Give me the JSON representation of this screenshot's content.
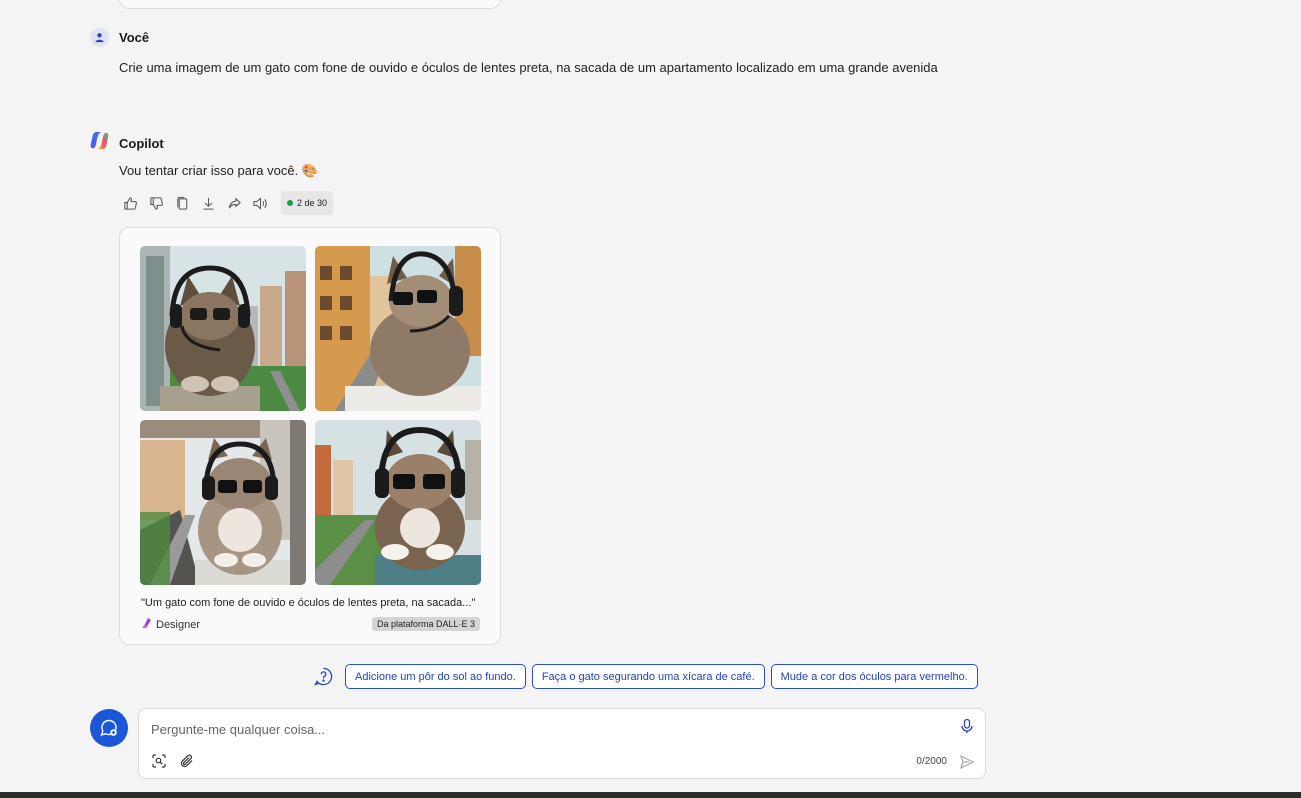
{
  "user_message": {
    "sender": "Você",
    "text": "Crie uma imagem de um gato com fone de ouvido e óculos de lentes preta, na sacada de um apartamento localizado em uma grande avenida"
  },
  "copilot_message": {
    "sender": "Copilot",
    "text": "Vou tentar criar isso para você. 🎨",
    "counter": "2 de 30",
    "counter_color": "#1a9c4b"
  },
  "image_card": {
    "caption": "\"Um gato com fone de ouvido e óculos de lentes preta, na sacada...\"",
    "designer_label": "Designer",
    "platform_label": "Da plataforma DALL·E 3"
  },
  "suggestions": [
    "Adicione um pôr do sol ao fundo.",
    "Faça o gato segurando uma xícara de café.",
    "Mude a cor dos óculos para vermelho."
  ],
  "composer": {
    "placeholder": "Pergunte-me qualquer coisa...",
    "char_count": "0/2000"
  },
  "colors": {
    "accent": "#1c56d8",
    "chip_border": "#2a4ec9"
  }
}
